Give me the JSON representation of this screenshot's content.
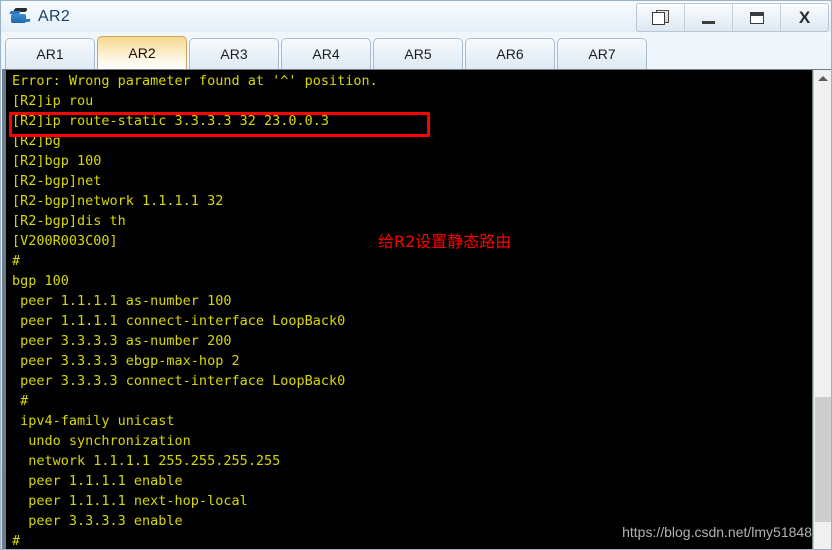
{
  "window": {
    "title": "AR2",
    "icon": "router-icon",
    "controls": [
      {
        "name": "restore-button",
        "icon": "restore-icon",
        "label": ""
      },
      {
        "name": "minimize-button",
        "icon": "minimize-icon",
        "label": ""
      },
      {
        "name": "maximize-button",
        "icon": "maximize-icon",
        "label": ""
      },
      {
        "name": "close-button",
        "icon": "close-icon",
        "label": "X"
      }
    ]
  },
  "tabs": [
    {
      "label": "AR1",
      "active": false
    },
    {
      "label": "AR2",
      "active": true
    },
    {
      "label": "AR3",
      "active": false
    },
    {
      "label": "AR4",
      "active": false
    },
    {
      "label": "AR5",
      "active": false
    },
    {
      "label": "AR6",
      "active": false
    },
    {
      "label": "AR7",
      "active": false
    }
  ],
  "terminal": {
    "foreground_color": "#d8d800",
    "background_color": "#000000",
    "lines": [
      "Error: Wrong parameter found at '^' position.",
      "[R2]ip rou",
      "[R2]ip route-static 3.3.3.3 32 23.0.0.3",
      "[R2]bg",
      "[R2]bgp 100",
      "[R2-bgp]net",
      "[R2-bgp]network 1.1.1.1 32",
      "[R2-bgp]dis th",
      "[V200R003C00]",
      "#",
      "bgp 100",
      " peer 1.1.1.1 as-number 100",
      " peer 1.1.1.1 connect-interface LoopBack0",
      " peer 3.3.3.3 as-number 200",
      " peer 3.3.3.3 ebgp-max-hop 2",
      " peer 3.3.3.3 connect-interface LoopBack0",
      " #",
      " ipv4-family unicast",
      "  undo synchronization",
      "  network 1.1.1.1 255.255.255.255",
      "  peer 1.1.1.1 enable",
      "  peer 1.1.1.1 next-hop-local",
      "  peer 3.3.3.3 enable",
      "#"
    ],
    "text": "Error: Wrong parameter found at '^' position.\n[R2]ip rou\n[R2]ip route-static 3.3.3.3 32 23.0.0.3\n[R2]bg\n[R2]bgp 100\n[R2-bgp]net\n[R2-bgp]network 1.1.1.1 32\n[R2-bgp]dis th\n[V200R003C00]\n#\nbgp 100\n peer 1.1.1.1 as-number 100\n peer 1.1.1.1 connect-interface LoopBack0\n peer 3.3.3.3 as-number 200\n peer 3.3.3.3 ebgp-max-hop 2\n peer 3.3.3.3 connect-interface LoopBack0\n #\n ipv4-family unicast\n  undo synchronization\n  network 1.1.1.1 255.255.255.255\n  peer 1.1.1.1 enable\n  peer 1.1.1.1 next-hop-local\n  peer 3.3.3.3 enable\n#"
  },
  "annotations": {
    "highlight_box": {
      "target_line": "[R2]ip route-static 3.3.3.3 32 23.0.0.3",
      "color": "#ff0000"
    },
    "note": {
      "text": "给R2设置静态路由",
      "color": "#ff0000"
    }
  },
  "watermark": {
    "text": "https://blog.csdn.net/lmy51848"
  },
  "scrollbar": {
    "up_arrow": "chevron-up-icon",
    "thumb_position": "bottom"
  }
}
